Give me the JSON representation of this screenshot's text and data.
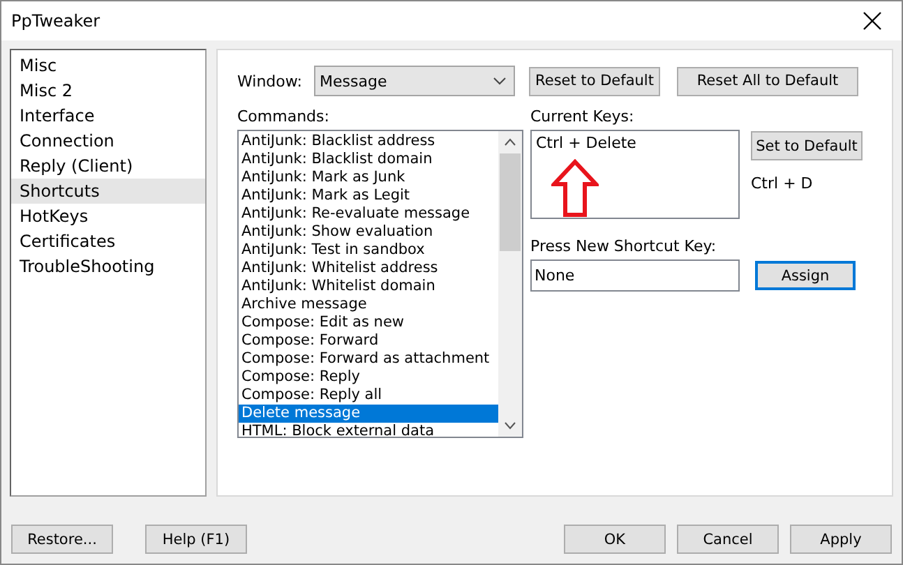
{
  "window": {
    "title": "PpTweaker"
  },
  "sidebar": {
    "items": [
      {
        "label": "Misc",
        "selected": false
      },
      {
        "label": "Misc 2",
        "selected": false
      },
      {
        "label": "Interface",
        "selected": false
      },
      {
        "label": "Connection",
        "selected": false
      },
      {
        "label": "Reply (Client)",
        "selected": false
      },
      {
        "label": "Shortcuts",
        "selected": true
      },
      {
        "label": "HotKeys",
        "selected": false
      },
      {
        "label": "Certificates",
        "selected": false
      },
      {
        "label": "TroubleShooting",
        "selected": false
      }
    ]
  },
  "window_select": {
    "label": "Window:",
    "value": "Message"
  },
  "reset_button": "Reset to Default",
  "reset_all_button": "Reset All to Default",
  "commands": {
    "label": "Commands:",
    "items": [
      {
        "label": "AntiJunk: Blacklist address",
        "selected": false
      },
      {
        "label": "AntiJunk: Blacklist domain",
        "selected": false
      },
      {
        "label": "AntiJunk: Mark as Junk",
        "selected": false
      },
      {
        "label": "AntiJunk: Mark as Legit",
        "selected": false
      },
      {
        "label": "AntiJunk: Re-evaluate message",
        "selected": false
      },
      {
        "label": "AntiJunk: Show evaluation",
        "selected": false
      },
      {
        "label": "AntiJunk: Test in sandbox",
        "selected": false
      },
      {
        "label": "AntiJunk: Whitelist address",
        "selected": false
      },
      {
        "label": "AntiJunk: Whitelist domain",
        "selected": false
      },
      {
        "label": "Archive message",
        "selected": false
      },
      {
        "label": "Compose: Edit as new",
        "selected": false
      },
      {
        "label": "Compose: Forward",
        "selected": false
      },
      {
        "label": "Compose: Forward as attachment",
        "selected": false
      },
      {
        "label": "Compose: Reply",
        "selected": false
      },
      {
        "label": "Compose: Reply all",
        "selected": false
      },
      {
        "label": "Delete message",
        "selected": true
      },
      {
        "label": "HTML: Block external data",
        "selected": false
      }
    ]
  },
  "current_keys": {
    "label": "Current Keys:",
    "items": [
      "Ctrl + Delete"
    ]
  },
  "set_default_button": "Set to Default",
  "default_keys": "Ctrl + D",
  "new_shortcut": {
    "label": "Press New Shortcut Key:",
    "value": "None"
  },
  "assign_button": {
    "label": "Assign",
    "focused": true
  },
  "footer_buttons": {
    "left": [
      "Restore...",
      "Help (F1)"
    ],
    "right": [
      "OK",
      "Cancel",
      "Apply"
    ]
  }
}
